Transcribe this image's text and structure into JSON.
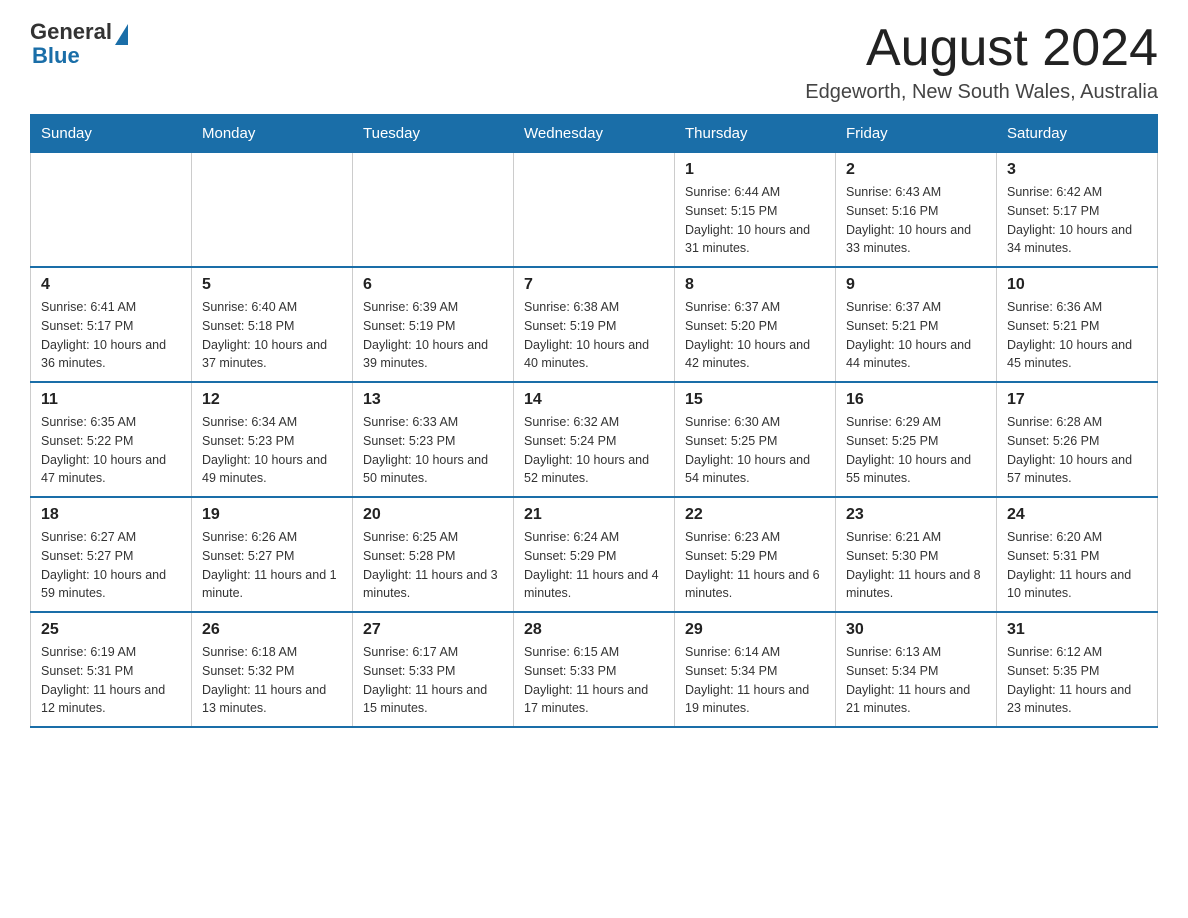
{
  "logo": {
    "text_general": "General",
    "text_blue": "Blue"
  },
  "title": "August 2024",
  "subtitle": "Edgeworth, New South Wales, Australia",
  "days": [
    "Sunday",
    "Monday",
    "Tuesday",
    "Wednesday",
    "Thursday",
    "Friday",
    "Saturday"
  ],
  "weeks": [
    [
      {
        "day": "",
        "info": ""
      },
      {
        "day": "",
        "info": ""
      },
      {
        "day": "",
        "info": ""
      },
      {
        "day": "",
        "info": ""
      },
      {
        "day": "1",
        "info": "Sunrise: 6:44 AM\nSunset: 5:15 PM\nDaylight: 10 hours and 31 minutes."
      },
      {
        "day": "2",
        "info": "Sunrise: 6:43 AM\nSunset: 5:16 PM\nDaylight: 10 hours and 33 minutes."
      },
      {
        "day": "3",
        "info": "Sunrise: 6:42 AM\nSunset: 5:17 PM\nDaylight: 10 hours and 34 minutes."
      }
    ],
    [
      {
        "day": "4",
        "info": "Sunrise: 6:41 AM\nSunset: 5:17 PM\nDaylight: 10 hours and 36 minutes."
      },
      {
        "day": "5",
        "info": "Sunrise: 6:40 AM\nSunset: 5:18 PM\nDaylight: 10 hours and 37 minutes."
      },
      {
        "day": "6",
        "info": "Sunrise: 6:39 AM\nSunset: 5:19 PM\nDaylight: 10 hours and 39 minutes."
      },
      {
        "day": "7",
        "info": "Sunrise: 6:38 AM\nSunset: 5:19 PM\nDaylight: 10 hours and 40 minutes."
      },
      {
        "day": "8",
        "info": "Sunrise: 6:37 AM\nSunset: 5:20 PM\nDaylight: 10 hours and 42 minutes."
      },
      {
        "day": "9",
        "info": "Sunrise: 6:37 AM\nSunset: 5:21 PM\nDaylight: 10 hours and 44 minutes."
      },
      {
        "day": "10",
        "info": "Sunrise: 6:36 AM\nSunset: 5:21 PM\nDaylight: 10 hours and 45 minutes."
      }
    ],
    [
      {
        "day": "11",
        "info": "Sunrise: 6:35 AM\nSunset: 5:22 PM\nDaylight: 10 hours and 47 minutes."
      },
      {
        "day": "12",
        "info": "Sunrise: 6:34 AM\nSunset: 5:23 PM\nDaylight: 10 hours and 49 minutes."
      },
      {
        "day": "13",
        "info": "Sunrise: 6:33 AM\nSunset: 5:23 PM\nDaylight: 10 hours and 50 minutes."
      },
      {
        "day": "14",
        "info": "Sunrise: 6:32 AM\nSunset: 5:24 PM\nDaylight: 10 hours and 52 minutes."
      },
      {
        "day": "15",
        "info": "Sunrise: 6:30 AM\nSunset: 5:25 PM\nDaylight: 10 hours and 54 minutes."
      },
      {
        "day": "16",
        "info": "Sunrise: 6:29 AM\nSunset: 5:25 PM\nDaylight: 10 hours and 55 minutes."
      },
      {
        "day": "17",
        "info": "Sunrise: 6:28 AM\nSunset: 5:26 PM\nDaylight: 10 hours and 57 minutes."
      }
    ],
    [
      {
        "day": "18",
        "info": "Sunrise: 6:27 AM\nSunset: 5:27 PM\nDaylight: 10 hours and 59 minutes."
      },
      {
        "day": "19",
        "info": "Sunrise: 6:26 AM\nSunset: 5:27 PM\nDaylight: 11 hours and 1 minute."
      },
      {
        "day": "20",
        "info": "Sunrise: 6:25 AM\nSunset: 5:28 PM\nDaylight: 11 hours and 3 minutes."
      },
      {
        "day": "21",
        "info": "Sunrise: 6:24 AM\nSunset: 5:29 PM\nDaylight: 11 hours and 4 minutes."
      },
      {
        "day": "22",
        "info": "Sunrise: 6:23 AM\nSunset: 5:29 PM\nDaylight: 11 hours and 6 minutes."
      },
      {
        "day": "23",
        "info": "Sunrise: 6:21 AM\nSunset: 5:30 PM\nDaylight: 11 hours and 8 minutes."
      },
      {
        "day": "24",
        "info": "Sunrise: 6:20 AM\nSunset: 5:31 PM\nDaylight: 11 hours and 10 minutes."
      }
    ],
    [
      {
        "day": "25",
        "info": "Sunrise: 6:19 AM\nSunset: 5:31 PM\nDaylight: 11 hours and 12 minutes."
      },
      {
        "day": "26",
        "info": "Sunrise: 6:18 AM\nSunset: 5:32 PM\nDaylight: 11 hours and 13 minutes."
      },
      {
        "day": "27",
        "info": "Sunrise: 6:17 AM\nSunset: 5:33 PM\nDaylight: 11 hours and 15 minutes."
      },
      {
        "day": "28",
        "info": "Sunrise: 6:15 AM\nSunset: 5:33 PM\nDaylight: 11 hours and 17 minutes."
      },
      {
        "day": "29",
        "info": "Sunrise: 6:14 AM\nSunset: 5:34 PM\nDaylight: 11 hours and 19 minutes."
      },
      {
        "day": "30",
        "info": "Sunrise: 6:13 AM\nSunset: 5:34 PM\nDaylight: 11 hours and 21 minutes."
      },
      {
        "day": "31",
        "info": "Sunrise: 6:12 AM\nSunset: 5:35 PM\nDaylight: 11 hours and 23 minutes."
      }
    ]
  ]
}
